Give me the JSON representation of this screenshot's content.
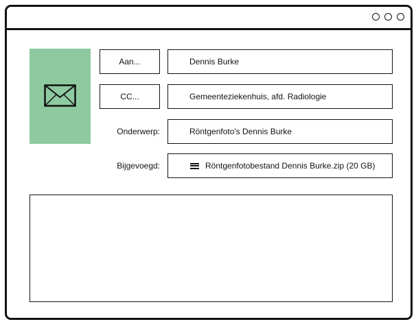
{
  "window": {
    "controls": [
      "window-control-dot",
      "window-control-dot",
      "window-control-dot"
    ]
  },
  "icon_panel": {
    "icon": "envelope-icon",
    "color": "#8dcaa0"
  },
  "fields": {
    "to": {
      "label": "Aan...",
      "value": "Dennis Burke"
    },
    "cc": {
      "label": "CC...",
      "value": "Gemeenteziekenhuis, afd. Radiologie"
    },
    "subject": {
      "label": "Onderwerp:",
      "value": "Röntgenfoto's Dennis Burke"
    },
    "attachment": {
      "label": "Bijgevoegd:",
      "icon": "attachment-lines-icon",
      "value": "Röntgenfotobestand Dennis Burke.zip (20 GB)"
    }
  },
  "message_body": {
    "value": ""
  }
}
